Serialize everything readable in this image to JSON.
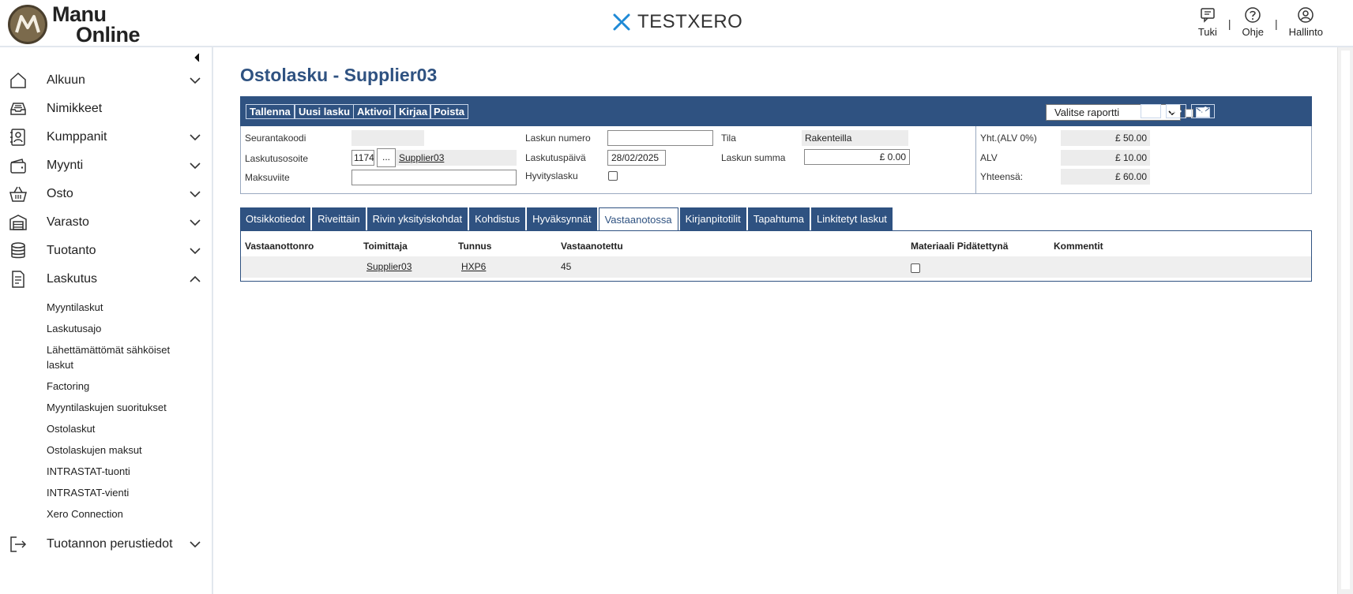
{
  "header": {
    "logo_line1": "Manu",
    "logo_line2": "Online",
    "company": "TESTXERO",
    "actions": [
      {
        "label": "Tuki",
        "icon": "chat-icon"
      },
      {
        "label": "Ohje",
        "icon": "help-icon"
      },
      {
        "label": "Hallinto",
        "icon": "user-icon"
      }
    ],
    "separator": "|"
  },
  "sidebar": {
    "items": [
      {
        "label": "Alkuun",
        "icon": "home-icon",
        "expandable": true
      },
      {
        "label": "Nimikkeet",
        "icon": "inbox-icon",
        "expandable": false
      },
      {
        "label": "Kumppanit",
        "icon": "contacts-icon",
        "expandable": true
      },
      {
        "label": "Myynti",
        "icon": "wallet-icon",
        "expandable": true
      },
      {
        "label": "Osto",
        "icon": "basket-icon",
        "expandable": true
      },
      {
        "label": "Varasto",
        "icon": "warehouse-icon",
        "expandable": true
      },
      {
        "label": "Tuotanto",
        "icon": "database-icon",
        "expandable": true
      },
      {
        "label": "Laskutus",
        "icon": "document-icon",
        "expandable": true,
        "expanded": true
      }
    ],
    "laskutus_subitems": [
      "Myyntilaskut",
      "Laskutusajo",
      "Lähettämättömät sähköiset laskut",
      "Factoring",
      "Myyntilaskujen suoritukset",
      "Ostolaskut",
      "Ostolaskujen maksut",
      "INTRASTAT-tuonti",
      "INTRASTAT-vienti",
      "Xero Connection"
    ],
    "bottom_item": {
      "label": "Tuotannon perustiedot",
      "icon": "exit-icon"
    }
  },
  "page": {
    "title": "Ostolasku - Supplier03"
  },
  "toolbar": {
    "buttons": [
      "Tallenna",
      "Uusi lasku",
      "Aktivoi",
      "Kirjaa",
      "Poista"
    ],
    "report_select": "Valitse raportti",
    "prev": "<<",
    "next": ">>"
  },
  "form": {
    "seurantakoodi_label": "Seurantakoodi",
    "seurantakoodi_value": "",
    "laskutusosoite_label": "Laskutusosoite",
    "laskutusosoite_id": "1174",
    "laskutusosoite_btn": "...",
    "laskutusosoite_name": "Supplier03",
    "maksuviite_label": "Maksuviite",
    "maksuviite_value": "",
    "laskun_numero_label": "Laskun numero",
    "laskun_numero_value": "",
    "laskutuspaiva_label": "Laskutuspäivä",
    "laskutuspaiva_value": "28/02/2025",
    "hyvityslasku_label": "Hyvityslasku",
    "hyvityslasku_checked": false,
    "tila_label": "Tila",
    "tila_value": "Rakenteilla",
    "laskun_summa_label": "Laskun summa",
    "laskun_summa_value": "£ 0.00",
    "yht_label": "Yht.(ALV 0%)",
    "yht_value": "£ 50.00",
    "alv_label": "ALV",
    "alv_value": "£ 10.00",
    "yhteensa_label": "Yhteensä:",
    "yhteensa_value": "£ 60.00"
  },
  "tabs": [
    {
      "label": "Otsikkotiedot",
      "active": false
    },
    {
      "label": "Riveittäin",
      "active": false
    },
    {
      "label": "Rivin yksityiskohdat",
      "active": false
    },
    {
      "label": "Kohdistus",
      "active": false
    },
    {
      "label": "Hyväksynnät",
      "active": false
    },
    {
      "label": "Vastaanotossa",
      "active": true
    },
    {
      "label": "Kirjanpitotilit",
      "active": false
    },
    {
      "label": "Tapahtuma",
      "active": false
    },
    {
      "label": "Linkitetyt laskut",
      "active": false
    }
  ],
  "grid": {
    "columns": [
      "Vastaanottonro",
      "Toimittaja",
      "Tunnus",
      "Vastaanotettu",
      "Materiaali Pidätettynä",
      "Kommentit"
    ],
    "rows": [
      {
        "vastaanottonro": "",
        "toimittaja": "Supplier03",
        "tunnus": "HXP6",
        "vastaanotettu": "45",
        "pidatetty": false,
        "kommentit": ""
      }
    ]
  },
  "colors": {
    "accent": "#2f5281",
    "brand_icon": "#1f8ad6"
  }
}
